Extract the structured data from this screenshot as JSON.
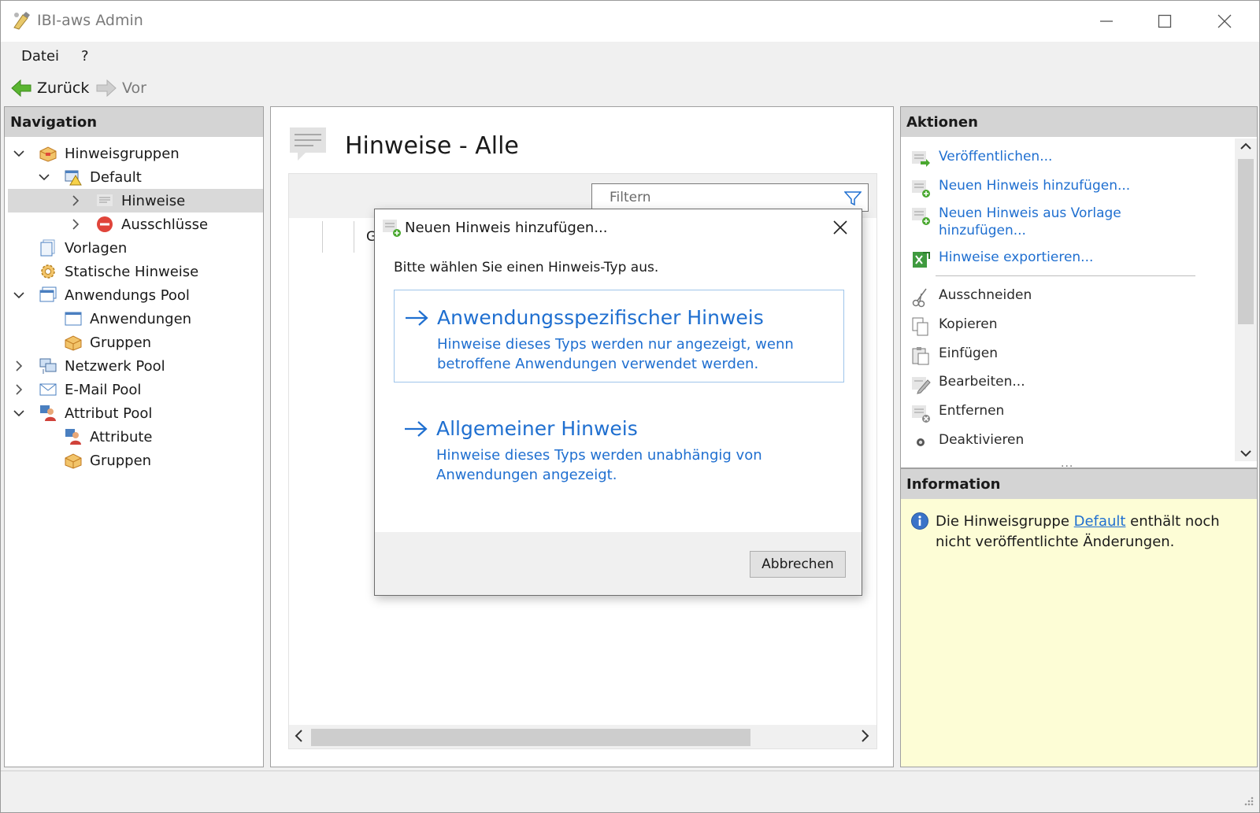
{
  "window": {
    "title": "IBI-aws Admin"
  },
  "menu": {
    "file": "Datei",
    "help": "?"
  },
  "toolbar": {
    "back": "Zurück",
    "forward": "Vor"
  },
  "navigation": {
    "header": "Navigation",
    "items": [
      {
        "label": "Hinweisgruppen",
        "icon": "folder-icon"
      },
      {
        "label": "Default",
        "icon": "warning-group-icon"
      },
      {
        "label": "Hinweise",
        "icon": "notes-icon"
      },
      {
        "label": "Ausschlüsse",
        "icon": "block-icon"
      },
      {
        "label": "Vorlagen",
        "icon": "template-icon"
      },
      {
        "label": "Statische Hinweise",
        "icon": "static-gear-icon"
      },
      {
        "label": "Anwendungs Pool",
        "icon": "window-pool-icon"
      },
      {
        "label": "Anwendungen",
        "icon": "window-icon"
      },
      {
        "label": "Gruppen",
        "icon": "box-icon"
      },
      {
        "label": "Netzwerk Pool",
        "icon": "network-icon"
      },
      {
        "label": "E-Mail Pool",
        "icon": "email-icon"
      },
      {
        "label": "Attribut Pool",
        "icon": "attribute-pool-icon"
      },
      {
        "label": "Attribute",
        "icon": "attribute-icon"
      },
      {
        "label": "Gruppen",
        "icon": "box-icon"
      }
    ]
  },
  "main": {
    "title": "Hinweise - Alle",
    "filter_placeholder": "Filtern",
    "column_fragment": "G"
  },
  "actions": {
    "header": "Aktionen",
    "items": [
      {
        "label": "Veröffentlichen...",
        "link": true
      },
      {
        "label": "Neuen Hinweis hinzufügen...",
        "link": true
      },
      {
        "label": "Neuen Hinweis aus Vorlage hinzufügen...",
        "link": true
      },
      {
        "label": "Hinweise exportieren...",
        "link": true
      },
      {
        "label": "Ausschneiden",
        "link": false
      },
      {
        "label": "Kopieren",
        "link": false
      },
      {
        "label": "Einfügen",
        "link": false
      },
      {
        "label": "Bearbeiten...",
        "link": false
      },
      {
        "label": "Entfernen",
        "link": false
      },
      {
        "label": "Deaktivieren",
        "link": false
      }
    ]
  },
  "information": {
    "header": "Information",
    "text_before": "Die Hinweisgruppe ",
    "link": "Default",
    "text_after": " enthält noch nicht veröffentlichte Änderungen."
  },
  "dialog": {
    "title": "Neuen Hinweis hinzufügen...",
    "prompt": "Bitte wählen Sie einen Hinweis-Typ aus.",
    "options": [
      {
        "title": "Anwendungsspezifischer Hinweis",
        "description": "Hinweise dieses Typs werden nur angezeigt,  wenn betroffene Anwendungen verwendet werden."
      },
      {
        "title": "Allgemeiner Hinweis",
        "description": "Hinweise dieses Typs werden unabhängig von Anwendungen angezeigt."
      }
    ],
    "cancel": "Abbrechen"
  },
  "colors": {
    "link": "#1f6fd0",
    "info_bg": "#fdfdd6",
    "header_bg": "#d4d4d4"
  }
}
